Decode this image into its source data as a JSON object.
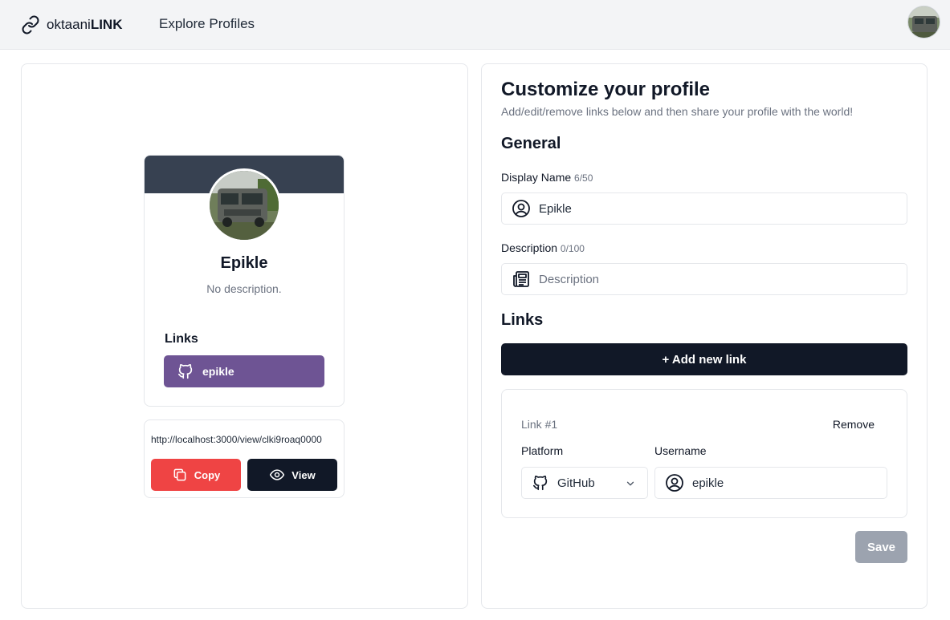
{
  "navbar": {
    "brand_prefix": "oktaani",
    "brand_suffix": "LINK",
    "explore_label": "Explore Profiles",
    "icons": {
      "brand": "link-icon",
      "avatar": "user-avatar"
    }
  },
  "preview": {
    "display_name": "Epikle",
    "description": "No description.",
    "links_title": "Links",
    "links": [
      {
        "platform": "GitHub",
        "username": "epikle",
        "icon": "github-icon",
        "color": "#6e5494"
      }
    ],
    "banner_color": "#374151"
  },
  "share": {
    "url": "http://localhost:3000/view/clki9roaq0000",
    "copy_label": "Copy",
    "view_label": "View",
    "copy_color": "#ef4444",
    "view_color": "#111827"
  },
  "form": {
    "title": "Customize your profile",
    "subtitle": "Add/edit/remove links below and then share your profile with the world!",
    "general_title": "General",
    "display_name_label": "Display Name",
    "display_name_count": "6/50",
    "display_name_value": "Epikle",
    "description_label": "Description",
    "description_count": "0/100",
    "description_placeholder": "Description",
    "links_title": "Links",
    "add_link_label": "+ Add new link",
    "link_items": [
      {
        "title": "Link #1",
        "remove_label": "Remove",
        "platform_label": "Platform",
        "platform_value": "GitHub",
        "username_label": "Username",
        "username_value": "epikle"
      }
    ],
    "save_label": "Save"
  }
}
